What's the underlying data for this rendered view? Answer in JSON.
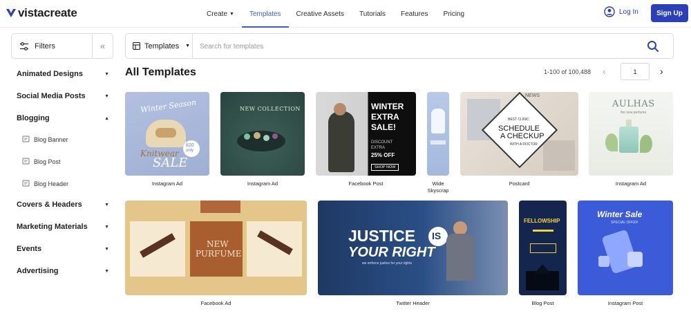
{
  "brand": {
    "name": "vistacreate",
    "accent": "#2a3fb8",
    "nav_active": "#3b5bdb"
  },
  "nav": {
    "items": [
      {
        "label": "Create",
        "dropdown": true
      },
      {
        "label": "Templates",
        "active": true
      },
      {
        "label": "Creative Assets"
      },
      {
        "label": "Tutorials"
      },
      {
        "label": "Features"
      },
      {
        "label": "Pricing"
      }
    ],
    "login": "Log In",
    "signup": "Sign Up"
  },
  "sidebar": {
    "filters_label": "Filters",
    "collapse_icon": "double-chevron-left-icon",
    "categories": [
      {
        "label": "Animated Designs",
        "expanded": false
      },
      {
        "label": "Social Media Posts",
        "expanded": false
      },
      {
        "label": "Blogging",
        "expanded": true,
        "children": [
          "Blog Banner",
          "Blog Post",
          "Blog Header"
        ]
      },
      {
        "label": "Covers & Headers",
        "expanded": false
      },
      {
        "label": "Marketing Materials",
        "expanded": false
      },
      {
        "label": "Events",
        "expanded": false
      },
      {
        "label": "Advertising",
        "expanded": false
      }
    ]
  },
  "search": {
    "type_label": "Templates",
    "placeholder": "Search for templates",
    "value": ""
  },
  "main": {
    "title": "All Templates",
    "pager": {
      "count": "1-100 of 100,488",
      "page": "1"
    }
  },
  "templates": [
    {
      "label": "Instagram Ad",
      "texts": [
        "Winter Season",
        "Knitwear",
        "SALE",
        "820",
        "only"
      ]
    },
    {
      "label": "Instagram Ad",
      "texts": [
        "NEW COLLECTION"
      ]
    },
    {
      "label": "Facebook Post",
      "texts": [
        "WINTER",
        "EXTRA",
        "SALE!",
        "DISCOUNT",
        "EXTRA",
        "25% OFF",
        "SHOP NOW"
      ]
    },
    {
      "label": "Wide Skyscrap",
      "texts": []
    },
    {
      "label": "Postcard",
      "texts": [
        "BEST CLINIC",
        "SCHEDULE",
        "A CHECKUP",
        "WITH A DOCTOR",
        "NEWS"
      ]
    },
    {
      "label": "Instagram Ad",
      "texts": [
        "AULHAS",
        "the new perfume"
      ]
    },
    {
      "label": "Facebook Ad",
      "texts": [
        "NEW",
        "PURFUME"
      ]
    },
    {
      "label": "Twitter Header",
      "texts": [
        "JUSTICE",
        "IS",
        "YOUR RIGHT",
        "we enforce justice for your rights"
      ]
    },
    {
      "label": "Blog Post",
      "texts": [
        "FELLOWSHIP"
      ]
    },
    {
      "label": "Instagram Post",
      "texts": [
        "Winter Sale",
        "SPECIAL OFFER"
      ]
    }
  ]
}
